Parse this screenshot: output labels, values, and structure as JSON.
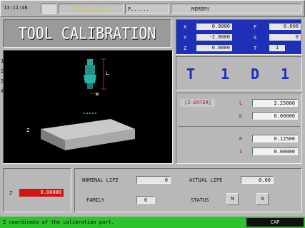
{
  "topbar": {
    "clock": "13:11:46",
    "mode": "CS-M11 LI-C8B",
    "program": "P......",
    "memory": "MEMORY"
  },
  "title": "TOOL CALIBRATION",
  "position": {
    "x_label": "X",
    "x_value": "0.0000",
    "y_label": "Y",
    "y_value": "-2.0000",
    "z_label": "Z",
    "z_value": "0.0000",
    "f_label": "F",
    "f_value": "0.000",
    "s_label": "S",
    "s_value": "0",
    "t_label": "T",
    "t_value": "1"
  },
  "tool_selection": {
    "t_label": "T",
    "t_value": "1",
    "d_label": "D",
    "d_value": "1"
  },
  "graphic": {
    "side_numbers": [
      "1",
      "2",
      "3",
      "4"
    ],
    "dim_l": "L",
    "dim_r": "R",
    "axis_z": "Z"
  },
  "offsets": {
    "mode_label": "[Z-ENTER]",
    "l_label": "L",
    "l_value": "2.25000",
    "k_label": "K",
    "k_value": "0.00000",
    "r_label": "R",
    "r_value": "0.12500",
    "i_label": "I",
    "i_value": "0.00000"
  },
  "z_input": {
    "label": "Z",
    "value": "0.00000"
  },
  "life": {
    "nominal_label": "NOMINAL LIFE",
    "nominal_value": "0",
    "actual_label": "ACTUAL LIFE",
    "actual_value": "0.00",
    "family_label": "FAMILY",
    "family_value": "0",
    "status_label": "STATUS",
    "status_btn1": "N",
    "status_btn2": "0"
  },
  "statusbar": {
    "message": "Z coordinate of the calibration part.",
    "caps": "CAP"
  },
  "colors": {
    "panel_blue": "#1e2fb8",
    "accent_red": "#d41212",
    "status_green": "#2fc22f",
    "label_red": "#a0193c"
  }
}
